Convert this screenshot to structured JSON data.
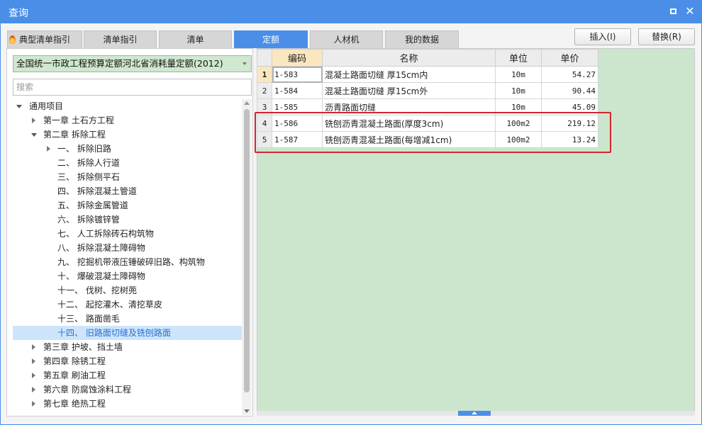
{
  "window": {
    "title": "查询"
  },
  "tabs": [
    {
      "label": "典型清单指引",
      "active": false,
      "icon": "fire-icon"
    },
    {
      "label": "清单指引",
      "active": false
    },
    {
      "label": "清单",
      "active": false
    },
    {
      "label": "定额",
      "active": true
    },
    {
      "label": "人材机",
      "active": false
    },
    {
      "label": "我的数据",
      "active": false
    }
  ],
  "actions": {
    "insert_label": "插入(I)",
    "replace_label": "替换(R)"
  },
  "left": {
    "dropdown_value": "全国统一市政工程预算定额河北省消耗量定额(2012)",
    "search_placeholder": "搜索",
    "tree": [
      {
        "label": "通用项目",
        "level": 0,
        "state": "expanded"
      },
      {
        "label": "第一章 土石方工程",
        "level": 1,
        "state": "collapsed"
      },
      {
        "label": "第二章 拆除工程",
        "level": 1,
        "state": "expanded"
      },
      {
        "label": "一、 拆除旧路",
        "level": 2,
        "state": "collapsed"
      },
      {
        "label": "二、 拆除人行道",
        "level": 2,
        "state": "leaf"
      },
      {
        "label": "三、 拆除侧平石",
        "level": 2,
        "state": "leaf"
      },
      {
        "label": "四、 拆除混凝土管道",
        "level": 2,
        "state": "leaf"
      },
      {
        "label": "五、 拆除金属管道",
        "level": 2,
        "state": "leaf"
      },
      {
        "label": "六、 拆除镀锌管",
        "level": 2,
        "state": "leaf"
      },
      {
        "label": "七、 人工拆除砖石构筑物",
        "level": 2,
        "state": "leaf"
      },
      {
        "label": "八、 拆除混凝土障碍物",
        "level": 2,
        "state": "leaf"
      },
      {
        "label": "九、 挖掘机带液压锤破碎旧路、构筑物",
        "level": 2,
        "state": "leaf"
      },
      {
        "label": "十、 爆破混凝土障碍物",
        "level": 2,
        "state": "leaf"
      },
      {
        "label": "十一、 伐树、挖树蔸",
        "level": 2,
        "state": "leaf"
      },
      {
        "label": "十二、 起挖灌木、清挖草皮",
        "level": 2,
        "state": "leaf"
      },
      {
        "label": "十三、 路面凿毛",
        "level": 2,
        "state": "leaf"
      },
      {
        "label": "十四、 旧路面切缝及铣刨路面",
        "level": 2,
        "state": "leaf",
        "selected": true
      },
      {
        "label": "第三章 护坡、挡土墙",
        "level": 1,
        "state": "collapsed"
      },
      {
        "label": "第四章 除锈工程",
        "level": 1,
        "state": "collapsed"
      },
      {
        "label": "第五章 刷油工程",
        "level": 1,
        "state": "collapsed"
      },
      {
        "label": "第六章 防腐蚀涂料工程",
        "level": 1,
        "state": "collapsed"
      },
      {
        "label": "第七章 绝热工程",
        "level": 1,
        "state": "collapsed"
      }
    ]
  },
  "grid": {
    "headers": {
      "code": "编码",
      "name": "名称",
      "unit": "单位",
      "price": "单价"
    },
    "rows": [
      {
        "no": "1",
        "code": "1-583",
        "name": "混凝土路面切缝 厚15cm内",
        "unit": "10m",
        "price": "54.27"
      },
      {
        "no": "2",
        "code": "1-584",
        "name": "混凝土路面切缝 厚15cm外",
        "unit": "10m",
        "price": "90.44"
      },
      {
        "no": "3",
        "code": "1-585",
        "name": "沥青路面切缝",
        "unit": "10m",
        "price": "45.09"
      },
      {
        "no": "4",
        "code": "1-586",
        "name": "铣刨沥青混凝土路面(厚度3cm)",
        "unit": "100m2",
        "price": "219.12"
      },
      {
        "no": "5",
        "code": "1-587",
        "name": "铣刨沥青混凝土路面(每增减1cm)",
        "unit": "100m2",
        "price": "13.24"
      }
    ]
  },
  "colors": {
    "accent": "#4a8ee8",
    "grid_bg": "#cbe6cd",
    "highlight": "#d4252e",
    "dropdown_bg": "#cfe8cf"
  }
}
